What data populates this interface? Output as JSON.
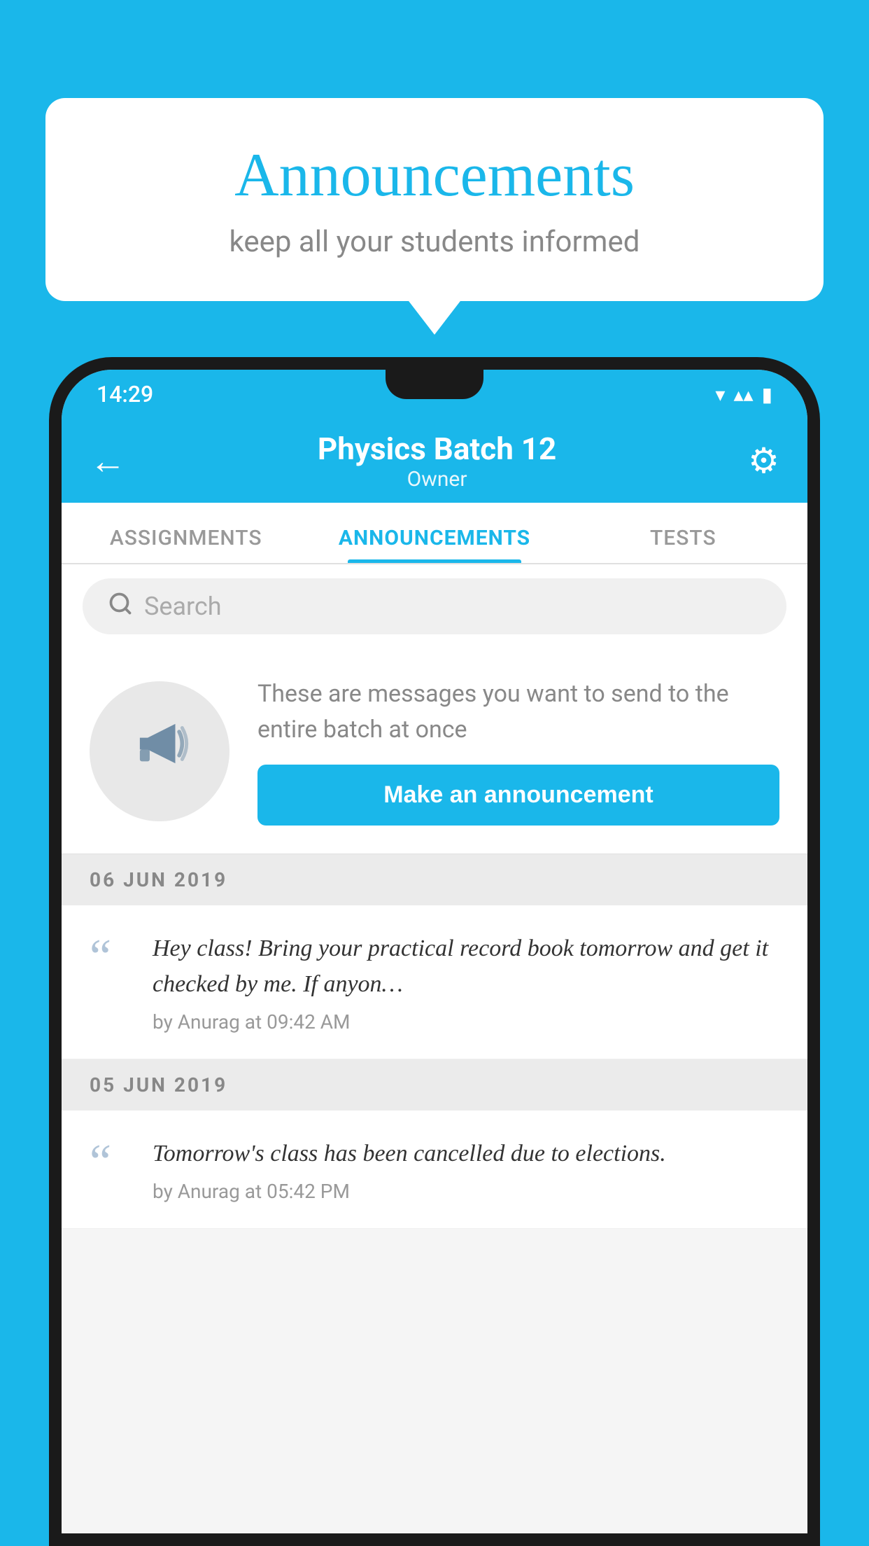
{
  "background_color": "#1ab7ea",
  "speech_bubble": {
    "title": "Announcements",
    "subtitle": "keep all your students informed"
  },
  "phone": {
    "status_bar": {
      "time": "14:29",
      "icons": "▾◂▮"
    },
    "header": {
      "title": "Physics Batch 12",
      "subtitle": "Owner",
      "back_label": "←",
      "gear_label": "⚙"
    },
    "tabs": [
      {
        "label": "ASSIGNMENTS",
        "active": false
      },
      {
        "label": "ANNOUNCEMENTS",
        "active": true
      },
      {
        "label": "TESTS",
        "active": false
      }
    ],
    "search": {
      "placeholder": "Search"
    },
    "empty_state": {
      "description": "These are messages you want to send to the entire batch at once",
      "button_label": "Make an announcement"
    },
    "announcements": [
      {
        "date": "06  JUN  2019",
        "message": "Hey class! Bring your practical record book tomorrow and get it checked by me. If anyon…",
        "meta": "by Anurag at 09:42 AM"
      },
      {
        "date": "05  JUN  2019",
        "message": "Tomorrow's class has been cancelled due to elections.",
        "meta": "by Anurag at 05:42 PM"
      }
    ]
  }
}
